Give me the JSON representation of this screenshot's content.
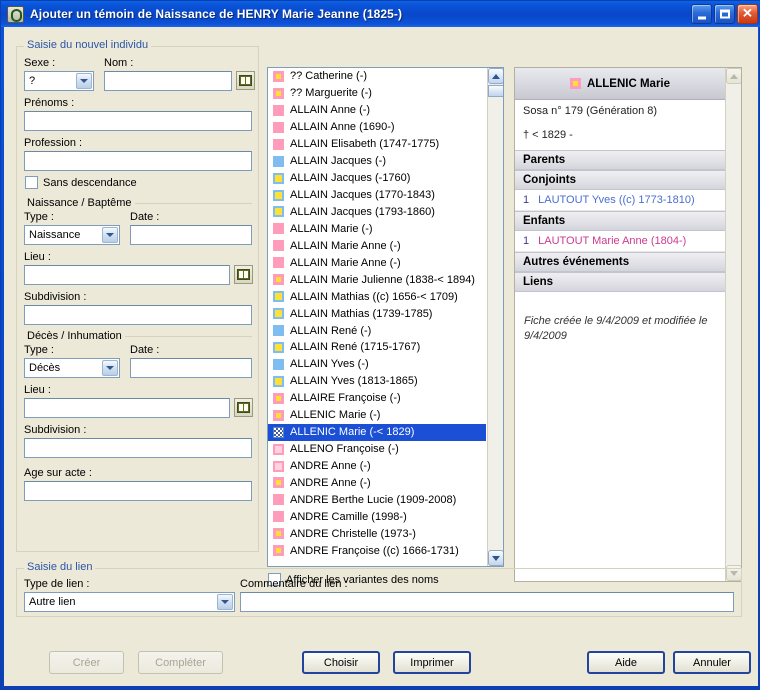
{
  "window": {
    "title": "Ajouter un témoin de Naissance de HENRY Marie Jeanne (1825-)",
    "icon": "app-icon",
    "minimize_label": "",
    "maximize_label": "",
    "close_label": "✕"
  },
  "new_individual": {
    "legend": "Saisie du nouvel individu",
    "sexe_label": "Sexe :",
    "sexe_value": "?",
    "nom_label": "Nom :",
    "nom_value": "",
    "nom_book_icon": "book-icon",
    "prenoms_label": "Prénoms :",
    "prenoms_value": "",
    "profession_label": "Profession :",
    "profession_value": "",
    "sans_descendance_label": "Sans descendance",
    "sans_descendance_checked": false,
    "birth": {
      "legend": "Naissance / Baptême",
      "type_label": "Type :",
      "type_value": "Naissance",
      "date_label": "Date :",
      "date_value": "",
      "lieu_label": "Lieu :",
      "lieu_value": "",
      "lieu_book_icon": "book-icon",
      "subdivision_label": "Subdivision :",
      "subdivision_value": ""
    },
    "death": {
      "legend": "Décès / Inhumation",
      "type_label": "Type :",
      "type_value": "Décès",
      "date_label": "Date :",
      "date_value": "",
      "lieu_label": "Lieu :",
      "lieu_value": "",
      "lieu_book_icon": "book-icon",
      "subdivision_label": "Subdivision :",
      "subdivision_value": "",
      "age_label": "Age sur acte :",
      "age_value": ""
    }
  },
  "list": {
    "show_variants_label": "Afficher les variantes des noms",
    "show_variants_checked": false,
    "scroll_up_icon": "chevron-up-icon",
    "scroll_down_icon": "chevron-down-icon",
    "items": [
      {
        "icon": "female-sosa",
        "text": "?? Catherine (-)",
        "selected": false
      },
      {
        "icon": "female-sosa",
        "text": "?? Marguerite (-)",
        "selected": false
      },
      {
        "icon": "female",
        "text": "ALLAIN Anne (-)",
        "selected": false
      },
      {
        "icon": "female",
        "text": "ALLAIN Anne (1690-)",
        "selected": false
      },
      {
        "icon": "female",
        "text": "ALLAIN Elisabeth (1747-1775)",
        "selected": false
      },
      {
        "icon": "male",
        "text": "ALLAIN Jacques (-)",
        "selected": false
      },
      {
        "icon": "male-sosa",
        "text": "ALLAIN Jacques (-1760)",
        "selected": false
      },
      {
        "icon": "male-sosa",
        "text": "ALLAIN Jacques (1770-1843)",
        "selected": false
      },
      {
        "icon": "male-sosa",
        "text": "ALLAIN Jacques (1793-1860)",
        "selected": false
      },
      {
        "icon": "female",
        "text": "ALLAIN Marie (-)",
        "selected": false
      },
      {
        "icon": "female",
        "text": "ALLAIN Marie Anne (-)",
        "selected": false
      },
      {
        "icon": "female",
        "text": "ALLAIN Marie Anne (-)",
        "selected": false
      },
      {
        "icon": "female-sosa",
        "text": "ALLAIN Marie Julienne (1838-< 1894)",
        "selected": false
      },
      {
        "icon": "male-sosa",
        "text": "ALLAIN Mathias ((c) 1656-< 1709)",
        "selected": false
      },
      {
        "icon": "male-sosa",
        "text": "ALLAIN Mathias (1739-1785)",
        "selected": false
      },
      {
        "icon": "male",
        "text": "ALLAIN René (-)",
        "selected": false
      },
      {
        "icon": "male-sosa",
        "text": "ALLAIN René (1715-1767)",
        "selected": false
      },
      {
        "icon": "male",
        "text": "ALLAIN Yves (-)",
        "selected": false
      },
      {
        "icon": "male-sosa",
        "text": "ALLAIN Yves (1813-1865)",
        "selected": false
      },
      {
        "icon": "female-sosa",
        "text": "ALLAIRE Françoise (-)",
        "selected": false
      },
      {
        "icon": "female-sosa",
        "text": "ALLENIC Marie (-)",
        "selected": false
      },
      {
        "icon": "dithered",
        "text": "ALLENIC Marie (-< 1829)",
        "selected": true
      },
      {
        "icon": "female-light",
        "text": "ALLENO Françoise (-)",
        "selected": false
      },
      {
        "icon": "female-light",
        "text": "ANDRE Anne (-)",
        "selected": false
      },
      {
        "icon": "female-sosa",
        "text": "ANDRE Anne (-)",
        "selected": false
      },
      {
        "icon": "female",
        "text": "ANDRE Berthe Lucie (1909-2008)",
        "selected": false
      },
      {
        "icon": "female",
        "text": "ANDRE Camille (1998-)",
        "selected": false
      },
      {
        "icon": "female-sosa",
        "text": "ANDRE Christelle (1973-)",
        "selected": false
      },
      {
        "icon": "female-sosa",
        "text": "ANDRE Françoise ((c) 1666-1731)",
        "selected": false
      }
    ]
  },
  "detail": {
    "name": "ALLENIC Marie",
    "name_icon": "female-sosa",
    "sosa": "Sosa n° 179 (Génération 8)",
    "dates": "†   < 1829 -",
    "sections": {
      "parents": "Parents",
      "conjoints": "Conjoints",
      "enfants": "Enfants",
      "autres": "Autres événements",
      "liens": "Liens"
    },
    "spouses": [
      {
        "num": "1",
        "text": "LAUTOUT Yves ((c) 1773-1810)"
      }
    ],
    "children": [
      {
        "num": "1",
        "text": "LAUTOUT Marie Anne (1804-)"
      }
    ],
    "note": "Fiche créée le 9/4/2009 et modifiée le 9/4/2009",
    "scroll_up_icon": "chevron-up-icon",
    "scroll_down_icon": "chevron-down-icon"
  },
  "link_entry": {
    "legend": "Saisie du lien",
    "type_label": "Type de lien :",
    "type_value": "Autre lien",
    "comment_label": "Commentaire du lien :",
    "comment_value": ""
  },
  "buttons": {
    "creer": "Créer",
    "completer": "Compléter",
    "choisir": "Choisir",
    "imprimer": "Imprimer",
    "aide": "Aide",
    "annuler": "Annuler"
  },
  "colors": {
    "titlebar": "#0a52d8",
    "dialog_bg": "#ece9d8",
    "selection": "#1a4fd6",
    "legend_text": "#2c55a8",
    "female": "#ff9bbb",
    "male": "#7fbdf0",
    "sosa": "#ffe033",
    "child_link": "#cc3a8e",
    "spouse_link": "#4a6fd0"
  }
}
